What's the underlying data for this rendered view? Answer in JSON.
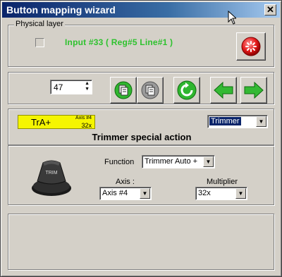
{
  "window": {
    "title": "Button mapping wizard",
    "close_glyph": "✕"
  },
  "physical_layer": {
    "legend": "Physical layer",
    "input_text": "Input #33 ( Reg#5  Line#1 )"
  },
  "controls": {
    "spin_value": "47",
    "icons": [
      "copy-green-icon",
      "copy-gray-icon",
      "refresh-icon",
      "arrow-left-icon",
      "arrow-right-icon"
    ]
  },
  "action": {
    "badge_main": "TrA+",
    "badge_axis": "Axis #4",
    "badge_multiplier": "32x",
    "type_selected": "Trimmer",
    "heading": "Trimmer special action",
    "function_label": "Function",
    "function_value": "Trimmer Auto +",
    "axis_label": "Axis :",
    "axis_value": "Axis #4",
    "multiplier_label": "Multiplier",
    "multiplier_value": "32x",
    "trim_knob_text": "TRIM"
  },
  "colors": {
    "accent_green": "#2ec22e",
    "badge_yellow": "#f5f500",
    "title_blue": "#0a246a"
  }
}
